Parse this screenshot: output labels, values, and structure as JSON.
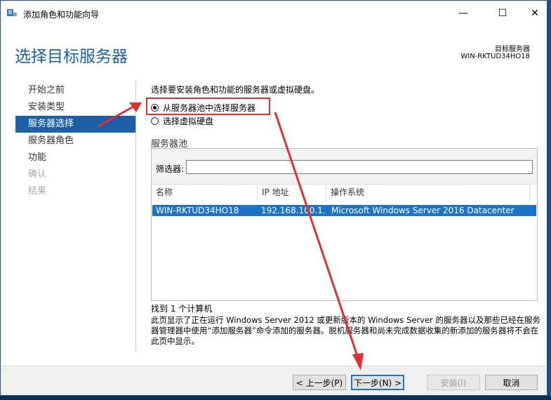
{
  "window": {
    "title": "添加角色和功能向导",
    "minimize_glyph": "—",
    "maximize_glyph": "☐",
    "close_glyph": "✕"
  },
  "header": {
    "page_title": "选择目标服务器",
    "target_label": "目标服务器",
    "target_name": "WIN-RKTUD34HO18"
  },
  "nav": {
    "items": [
      {
        "label": "开始之前",
        "state": "normal"
      },
      {
        "label": "安装类型",
        "state": "normal"
      },
      {
        "label": "服务器选择",
        "state": "active"
      },
      {
        "label": "服务器角色",
        "state": "normal"
      },
      {
        "label": "功能",
        "state": "normal"
      },
      {
        "label": "确认",
        "state": "disabled"
      },
      {
        "label": "结果",
        "state": "disabled"
      }
    ]
  },
  "main": {
    "instruction": "选择要安装角色和功能的服务器或虚拟硬盘。",
    "radio_pool": "从服务器池中选择服务器",
    "radio_vhd": "选择虚拟硬盘",
    "pool_label": "服务器池",
    "filter_label": "筛选器:",
    "filter_value": "",
    "columns": [
      "名称",
      "IP 地址",
      "操作系统"
    ],
    "rows": [
      {
        "name": "WIN-RKTUD34HO18",
        "ip": "192.168.100.1...",
        "os": "Microsoft Windows Server 2016 Datacenter"
      }
    ],
    "found": "找到 1 个计算机",
    "description": "此页显示了正在运行 Windows Server 2012 或更新版本的 Windows Server 的服务器以及那些已经在服务器管理器中使用“添加服务器”命令添加的服务器。脱机服务器和尚未完成数据收集的新添加的服务器将不会在此页中显示。"
  },
  "footer": {
    "prev": "< 上一步(P)",
    "next": "下一步(N) >",
    "install": "安装(I)",
    "cancel": "取消"
  },
  "colors": {
    "accent": "#1c5fa8",
    "selection": "#1c73c8",
    "annotation_red": "#e03030"
  }
}
